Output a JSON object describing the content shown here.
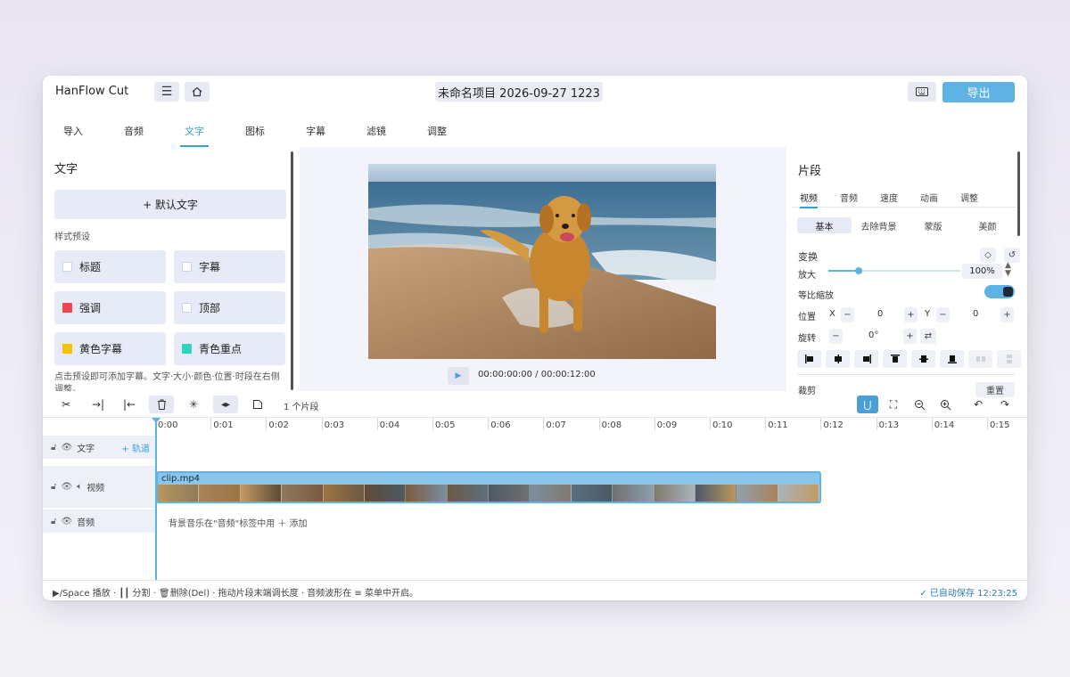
{
  "app": {
    "name": "HanFlow Cut",
    "project_title": "未命名项目 2026-09-27 1223",
    "export_label": "导出"
  },
  "tabs": [
    {
      "label": "导入",
      "active": false
    },
    {
      "label": "音频",
      "active": false
    },
    {
      "label": "文字",
      "active": true
    },
    {
      "label": "图标",
      "active": false
    },
    {
      "label": "字幕",
      "active": false
    },
    {
      "label": "滤镜",
      "active": false
    },
    {
      "label": "调整",
      "active": false
    }
  ],
  "left_panel": {
    "title": "文字",
    "default_text_button": "+  默认文字",
    "presets_label": "样式预设",
    "presets": [
      {
        "label": "标题",
        "color": "#ffffff"
      },
      {
        "label": "字幕",
        "color": "#ffffff"
      },
      {
        "label": "强调",
        "color": "#f0454f"
      },
      {
        "label": "顶部",
        "color": "#ffffff"
      },
      {
        "label": "黄色字幕",
        "color": "#f5c400"
      },
      {
        "label": "青色重点",
        "color": "#2fd3c2"
      }
    ],
    "hint": "点击预设即可添加字幕。文字·大小·颜色·位置·时段在右侧调整。"
  },
  "preview": {
    "timecode": "00:00:00:00 / 00:00:12:00"
  },
  "right_panel": {
    "title": "片段",
    "tabs": [
      {
        "label": "视频",
        "active": true
      },
      {
        "label": "音频",
        "active": false
      },
      {
        "label": "速度",
        "active": false
      },
      {
        "label": "动画",
        "active": false
      },
      {
        "label": "调整",
        "active": false
      }
    ],
    "segments": [
      {
        "label": "基本",
        "active": true
      },
      {
        "label": "去除背景",
        "active": false
      },
      {
        "label": "蒙版",
        "active": false
      },
      {
        "label": "美颜",
        "active": false
      }
    ],
    "transform_label": "变换",
    "scale_label": "放大",
    "scale_value": "100%",
    "scale_fraction": 0.23,
    "uniform_scale_label": "等比缩放",
    "uniform_scale_on": true,
    "position_label": "位置",
    "x_label": "X",
    "x_value": "0",
    "y_label": "Y",
    "y_value": "0",
    "rotation_label": "旋转",
    "rotation_value": "0°",
    "crop_label": "裁剪",
    "reset_label": "重置"
  },
  "toolbar": {
    "clip_count": "1 个片段"
  },
  "timeline": {
    "ruler": [
      "0:00",
      "0:01",
      "0:02",
      "0:03",
      "0:04",
      "0:05",
      "0:06",
      "0:07",
      "0:08",
      "0:09",
      "0:10",
      "0:11",
      "0:12",
      "0:13",
      "0:14",
      "0:15"
    ],
    "tracks": {
      "text": {
        "label": "文字",
        "add_label": "+ 轨道"
      },
      "video": {
        "label": "视频"
      },
      "audio": {
        "label": "音频"
      }
    },
    "clip_name": "clip.mp4",
    "audio_hint": "背景音乐在\"音频\"标签中用 ＋ 添加"
  },
  "statusbar": {
    "left": "▶/Space 播放 · ┃┃ 分割 · 🗑删除(Del) · 拖动片段末端调长度 · 音频波形在 ≡ 菜单中开启。",
    "right": "✓ 已自动保存 12:23:25"
  },
  "colors": {
    "accent": "#5fb2e4",
    "tab_active": "#3a9fd8"
  }
}
